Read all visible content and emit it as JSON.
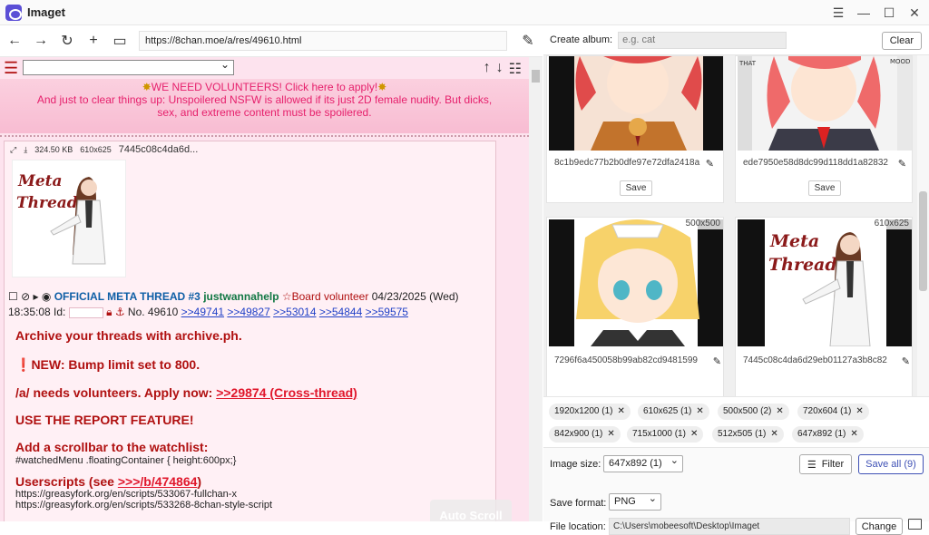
{
  "app": {
    "title": "Imaget"
  },
  "browser": {
    "url": "https://8chan.moe/a/res/49610.html"
  },
  "chan": {
    "banner_line1": "WE NEED VOLUNTEERS! Click here to apply!",
    "banner_line2": "And just to clear things up: Unspoilered NSFW is allowed if its just 2D female nudity. But dicks, sex, and extreme content must be spoilered.",
    "file_size": "324.50 KB",
    "file_dims": "610x625",
    "file_hash": "7445c08c4da6d...",
    "thumb_text": "Meta Thread",
    "post": {
      "subject": "OFFICIAL META THREAD #3",
      "name": "justwannahelp",
      "role": "☆Board volunteer",
      "date": "04/23/2025 (Wed)",
      "time": "18:35:08 Id:",
      "number": "No. 49610",
      "replies": [
        ">>49741",
        ">>49827",
        ">>53014",
        ">>54844",
        ">>59575"
      ]
    },
    "body": {
      "l1": "Archive your threads with archive.ph.",
      "l2": "NEW: Bump limit set to 800.",
      "l3": "/a/ needs volunteers. Apply now: ",
      "l3_link": ">>29874 (Cross-thread)",
      "l4": "USE THE REPORT FEATURE!",
      "l5": "Add a scrollbar to the watchlist:",
      "l5_code": "#watchedMenu .floatingContainer {  height:600px;}",
      "l6": "Userscripts (see ",
      "l6_link": ">>>/b/474864",
      "l6_end": ")",
      "url1": "https://greasyfork.org/en/scripts/533067-fullchan-x",
      "url2": "https://greasyfork.org/en/scripts/533268-8chan-style-script"
    },
    "auto_scroll": "Auto Scroll"
  },
  "panel": {
    "album_label": "Create album:",
    "album_placeholder": "e.g. cat",
    "clear": "Clear",
    "cards": [
      {
        "name": "8c1b9edc77b2b0dfe97e72dfa2418a",
        "save": "Save"
      },
      {
        "name": "ede7950e58d8dc99d118dd1a82832",
        "save": "Save"
      },
      {
        "name": "7296f6a450058b99ab82cd9481599",
        "dims": "500x500"
      },
      {
        "name": "7445c08c4da6d29eb01127a3b8c82",
        "dims": "610x625",
        "thumb_text": "Meta Thread"
      }
    ],
    "tags": [
      "1920x1200 (1)",
      "610x625 (1)",
      "500x500 (2)",
      "720x604 (1)",
      "842x900 (1)",
      "715x1000 (1)",
      "512x505 (1)",
      "647x892 (1)"
    ],
    "image_size_label": "Image size:",
    "image_size_value": "647x892 (1)",
    "filter": "Filter",
    "save_all": "Save all (9)",
    "save_format_label": "Save format:",
    "save_format_value": "PNG",
    "file_location_label": "File location:",
    "file_location": "C:\\Users\\mobeesoft\\Desktop\\Imaget",
    "change": "Change"
  }
}
